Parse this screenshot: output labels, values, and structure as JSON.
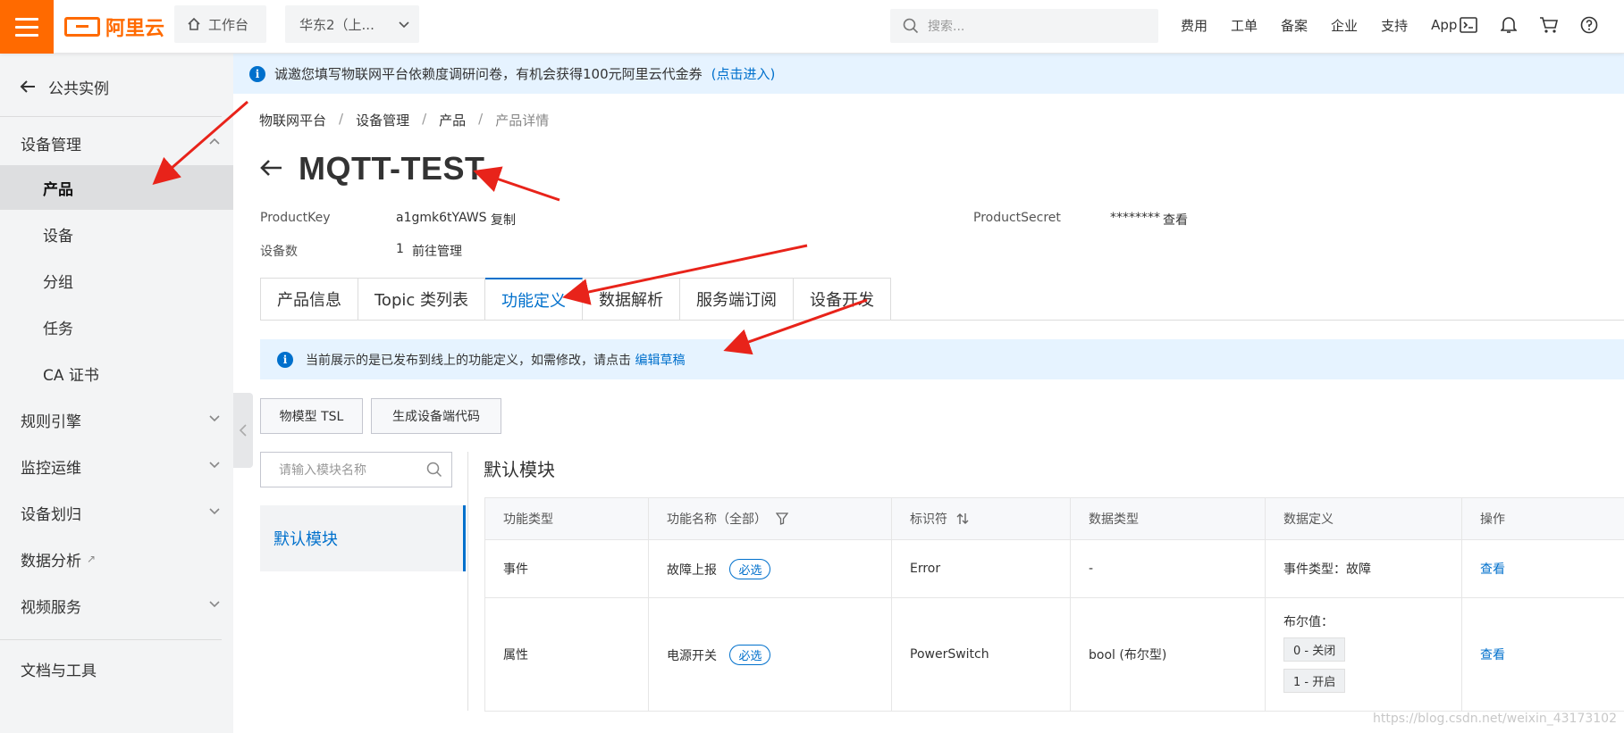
{
  "topbar": {
    "logo_text": "阿里云",
    "workbench_label": "工作台",
    "region_label": "华东2（上...",
    "search_placeholder": "搜索...",
    "links": [
      "费用",
      "工单",
      "备案",
      "企业",
      "支持",
      "App"
    ],
    "icons": [
      "terminal-icon",
      "bell-icon",
      "cart-icon",
      "help-icon"
    ]
  },
  "sidebar": {
    "back_label": "公共实例",
    "groups": {
      "device_mgmt": "设备管理",
      "product": "产品",
      "device": "设备",
      "group": "分组",
      "task": "任务",
      "ca": "CA 证书",
      "rules": "规则引擎",
      "monitor": "监控运维",
      "assign": "设备划归",
      "analysis": "数据分析",
      "video": "视频服务",
      "docs": "文档与工具"
    }
  },
  "notice": {
    "text": "诚邀您填写物联网平台依赖度调研问卷，有机会获得100元阿里云代金券",
    "link": "(点击进入)"
  },
  "breadcrumb": [
    "物联网平台",
    "设备管理",
    "产品",
    "产品详情"
  ],
  "product": {
    "name": "MQTT-TEST",
    "key_label": "ProductKey",
    "key_value": "a1gmk6tYAWS",
    "copy_label": "复制",
    "secret_label": "ProductSecret",
    "secret_value": "********",
    "view_label": "查看",
    "count_label": "设备数",
    "count_value": "1",
    "manage_label": "前往管理"
  },
  "tabs": [
    "产品信息",
    "Topic 类列表",
    "功能定义",
    "数据解析",
    "服务端订阅",
    "设备开发"
  ],
  "active_tab": "功能定义",
  "info_bar": {
    "text": "当前展示的是已发布到线上的功能定义，如需修改，请点击",
    "link": "编辑草稿"
  },
  "buttons": {
    "tsl": "物模型 TSL",
    "gen_code": "生成设备端代码"
  },
  "module": {
    "search_placeholder": "请输入模块名称",
    "default_item": "默认模块",
    "title": "默认模块"
  },
  "table": {
    "headers": [
      "功能类型",
      "功能名称（全部）",
      "标识符",
      "数据类型",
      "数据定义",
      "操作"
    ],
    "rows": [
      {
        "type": "事件",
        "name": "故障上报",
        "required": "必选",
        "identifier": "Error",
        "data_type": "-",
        "definition": "事件类型：故障",
        "action": "查看"
      },
      {
        "type": "属性",
        "name": "电源开关",
        "required": "必选",
        "identifier": "PowerSwitch",
        "data_type": "bool (布尔型)",
        "definition_label": "布尔值：",
        "bool_values": [
          "0 - 关闭",
          "1 - 开启"
        ],
        "action": "查看"
      }
    ]
  },
  "colors": {
    "brand": "#ff6a00",
    "link": "#0070cc",
    "annotation": "#e8231a"
  },
  "watermark": "https://blog.csdn.net/weixin_43173102"
}
